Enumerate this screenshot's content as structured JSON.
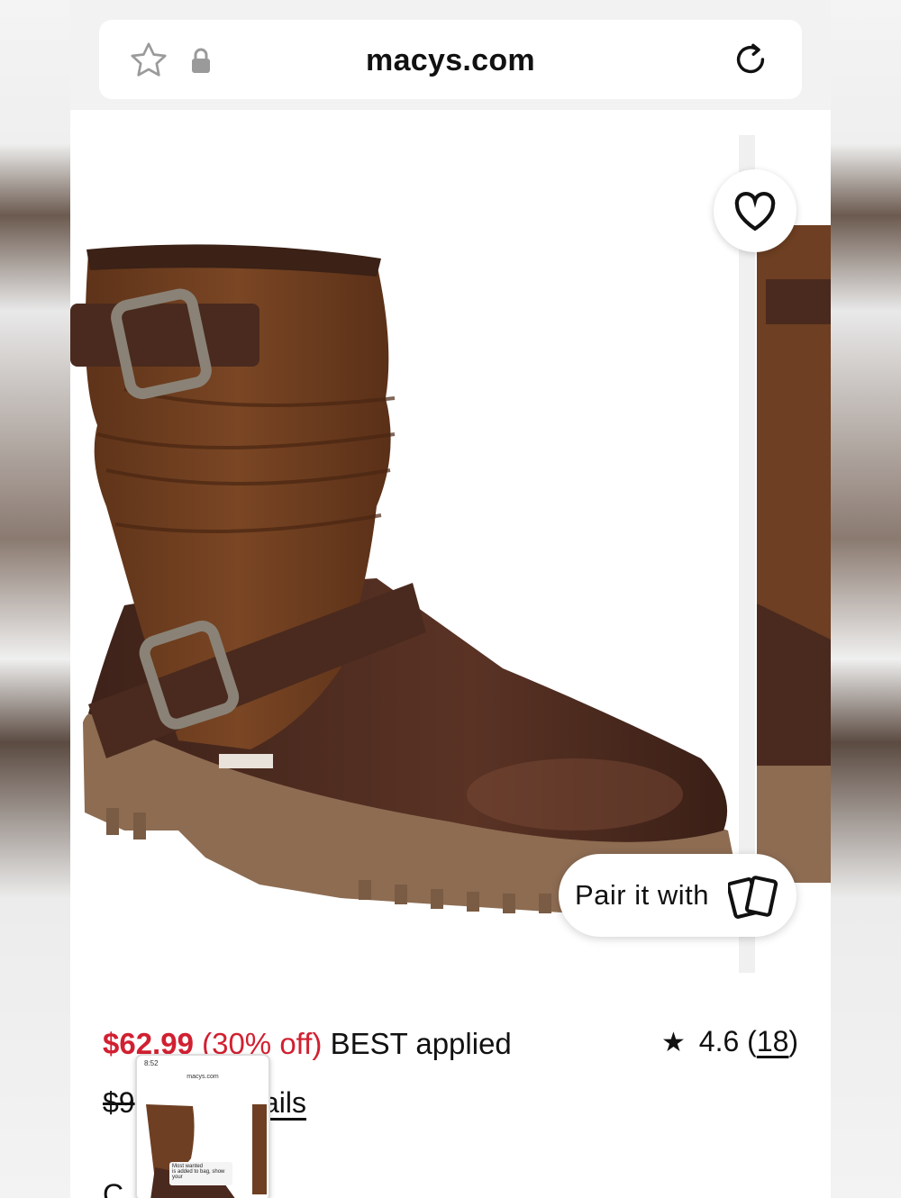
{
  "browser": {
    "url": "macys.com"
  },
  "product": {
    "image_alt": "Brown leather and suede buckle boot",
    "wishlist_icon": "heart-icon",
    "pair_label": "Pair it with",
    "pair_icon": "cards-icon"
  },
  "pricing": {
    "sale_price": "$62.99",
    "discount": "(30% off)",
    "promo": "BEST applied",
    "original_price": "$9",
    "details_link": "ails"
  },
  "rating": {
    "value": "4.6",
    "count_open": "(",
    "count": "18",
    "count_close": ")"
  },
  "bottom": {
    "partial_text": "C"
  },
  "thumbnail": {
    "time": "8:52",
    "url": "macys.com",
    "toast_title": "Most wanted",
    "toast_body": "is added to bag, show your"
  },
  "colors": {
    "sale_red": "#d12031",
    "boot_brown": "#5a3325",
    "suede_brown": "#6e3f22",
    "sole": "#8a6a50"
  }
}
